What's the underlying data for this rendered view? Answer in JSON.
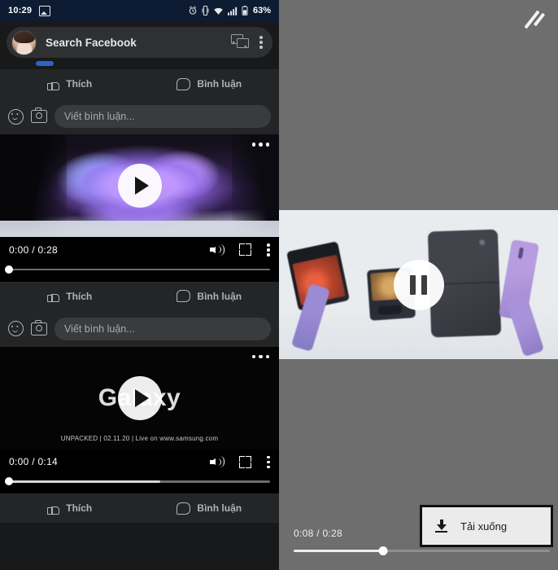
{
  "left_panel": {
    "statusbar": {
      "time": "10:29",
      "battery": "63%",
      "icons": [
        "image-icon",
        "alarm-icon",
        "vibrate-icon",
        "wifi-icon",
        "signal-icon",
        "battery-icon"
      ]
    },
    "search": {
      "placeholder": "Search Facebook",
      "messenger_icon": "messenger-icon",
      "menu_icon": "kebab-menu-icon"
    },
    "post_top": {
      "like_label": "Thích",
      "comment_label": "Bình luận",
      "composer_placeholder": "Viết bình luận..."
    },
    "video_one": {
      "current_time": "0:00",
      "duration": "0:28",
      "time_display": "0:00 / 0:28",
      "progress_percent": 0,
      "buffered_percent": 0,
      "like_label": "Thích",
      "comment_label": "Bình luận",
      "composer_placeholder": "Viết bình luận..."
    },
    "video_two": {
      "brand_text": "Galaxy",
      "caption": "UNPACKED | 02.11.20 | Live on www.samsung.com",
      "current_time": "0:00",
      "duration": "0:14",
      "time_display": "0:00 / 0:14",
      "progress_percent": 0,
      "buffered_percent": 58,
      "like_label": "Thích",
      "comment_label": "Bình luận"
    }
  },
  "right_panel": {
    "top_icon": "rotate-screen-icon",
    "player": {
      "state": "playing",
      "pause_icon": "pause-icon",
      "current_time": "0:08",
      "duration": "0:28",
      "time_display": "0:08 / 0:28",
      "progress_percent": 35,
      "buffered_percent": 35
    },
    "download_button": {
      "label": "Tải xuống",
      "icon": "download-icon"
    }
  },
  "colors": {
    "statusbar_bg": "#0d1b33",
    "app_bg": "#18191a",
    "card_bg": "#242526",
    "field_bg": "#3a3b3c",
    "text_primary": "#e4e6eb",
    "text_secondary": "#b0b3b8",
    "accent_blue": "#2d64c8",
    "right_panel_bg": "#6e6e6e",
    "download_btn_bg": "#ebebeb"
  }
}
